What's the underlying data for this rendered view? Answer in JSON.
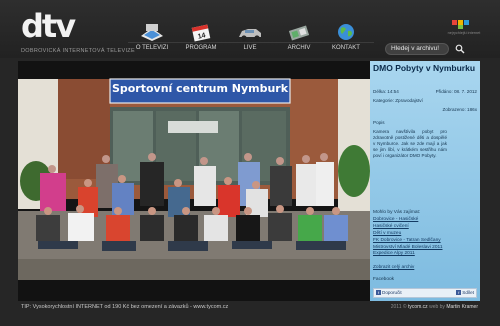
{
  "header": {
    "logo_text": "dtv",
    "tagline": "DOBROVICKÁ INTERNETOVÁ TELEVIZE",
    "nav": [
      {
        "label": "O TELEVIZI",
        "icon": "tv-icon"
      },
      {
        "label": "PROGRAM",
        "icon": "calendar-icon"
      },
      {
        "label": "LIVE",
        "icon": "car-icon"
      },
      {
        "label": "ARCHIV",
        "icon": "film-icon"
      },
      {
        "label": "KONTAKT",
        "icon": "globe-icon"
      }
    ],
    "partner_caption": "nejrychlejší internet",
    "search": {
      "placeholder": "Hledej v archivu!"
    }
  },
  "photo": {
    "sign_text": "Sportovní centrum Nymburk"
  },
  "info": {
    "title": "DMO Pobyty v Nymburku",
    "length_label": "Délka: 14:54",
    "date_label": "Přidáno: 08. 7. 2012",
    "category_label": "Kategorie: Zpravodajství",
    "views_label": "Zobrazeno: 186x",
    "description_label": "Popis",
    "description": "Kamera navštívila pobyt pro zdravotně postižené děti a dospělé v Nymburce. Jak se zde mají a jak se jim líbí, v krátkém sestřihu nám poví i organizátor DMO Pobyty.",
    "links": [
      {
        "text": "Mohlo by Vás zajímat:",
        "link": false
      },
      {
        "text": "Dobrovice - Hasičské",
        "link": true
      },
      {
        "text": "Hasičské cvičení",
        "link": true
      },
      {
        "text": "Dětí v muzeu",
        "link": true
      },
      {
        "text": "FK Dobrovice - Tatran Sedlčany",
        "link": true
      },
      {
        "text": "Mistrovství Mladé Boleslavi 2011",
        "link": true
      },
      {
        "text": "Expedice Alpy 2011",
        "link": true
      }
    ],
    "show_all": "Zobrazit celý archiv",
    "facebook_label": "Facebook",
    "fb_recommend": "Doporučit",
    "fb_share": "Sdílet"
  },
  "footer": {
    "tip": "TIP: Vysokorychlostní INTERNET od 190 Kč bez omezení a závazků - www.tycom.cz",
    "credit_prefix": "2011 © ",
    "credit_site": "tycom.cz",
    "credit_middle": " web by ",
    "credit_author": "Martin Kramer"
  },
  "colors": {
    "background": "#262626",
    "info_panel": "#a9d6ef",
    "link": "#133a62",
    "sign": "#2e57a8"
  }
}
